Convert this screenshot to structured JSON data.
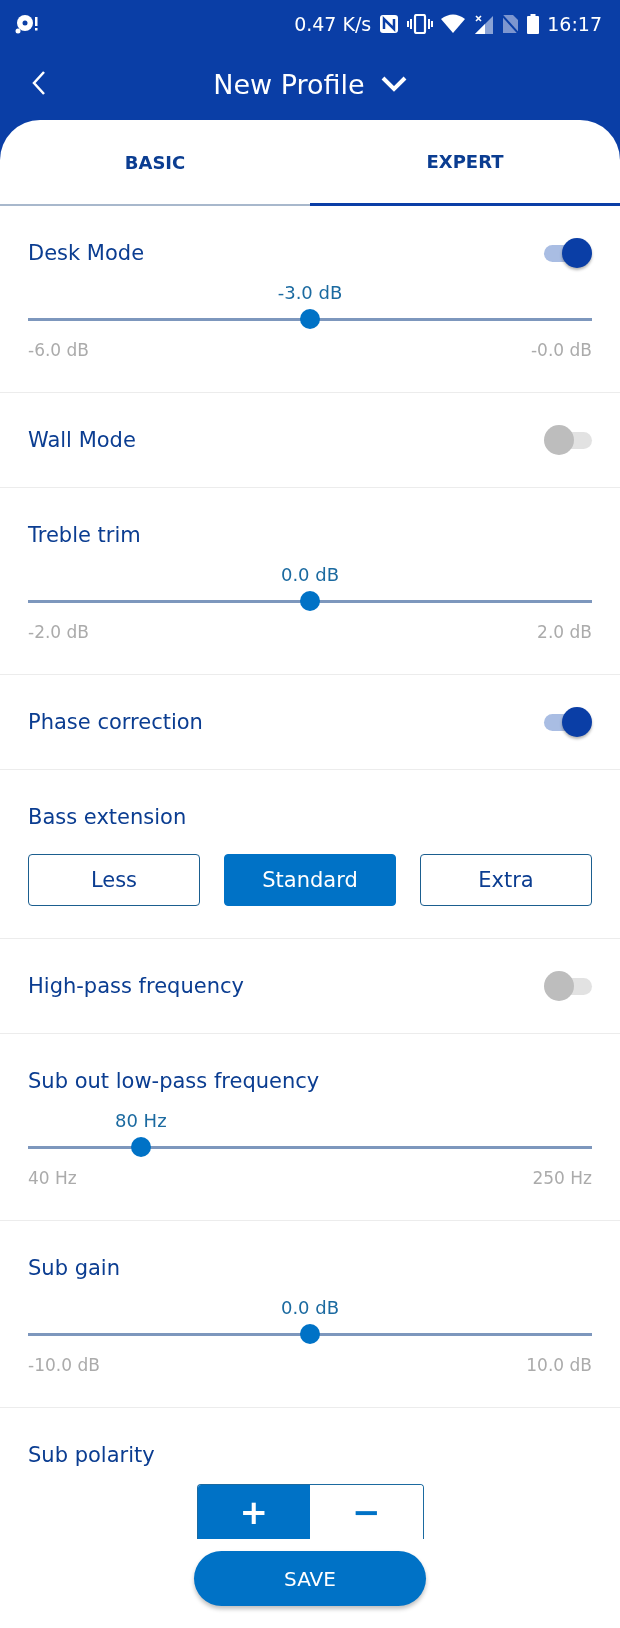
{
  "status_bar": {
    "speed": "0.47 K/s",
    "time": "16:17"
  },
  "header": {
    "title": "New Profile"
  },
  "tabs": [
    {
      "label": "BASIC",
      "selected": false
    },
    {
      "label": "EXPERT",
      "selected": true
    }
  ],
  "sections": [
    {
      "kind": "toggle",
      "label": "Desk Mode",
      "on": true,
      "slider": {
        "value": "-3.0 dB",
        "min": "-6.0 dB",
        "max": "-0.0 dB",
        "level": 0.5
      }
    },
    {
      "kind": "toggle",
      "label": "Wall Mode",
      "on": false
    },
    {
      "kind": "slider",
      "label": "Treble trim",
      "slider": {
        "value": "0.0 dB",
        "min": "-2.0 dB",
        "max": "2.0 dB",
        "level": 0.5
      }
    },
    {
      "kind": "toggle",
      "label": "Phase correction",
      "on": true
    },
    {
      "kind": "choice",
      "label": "Bass extension",
      "options": [
        {
          "label": "Less",
          "selected": false
        },
        {
          "label": "Standard",
          "selected": true
        },
        {
          "label": "Extra",
          "selected": false
        }
      ]
    },
    {
      "kind": "toggle",
      "label": "High-pass frequency",
      "on": false
    },
    {
      "kind": "slider",
      "label": "Sub out low-pass frequency",
      "slider": {
        "value": "80 Hz",
        "min": "40 Hz",
        "max": "250 Hz",
        "level": 0.2
      }
    },
    {
      "kind": "slider",
      "label": "Sub gain",
      "slider": {
        "value": "0.0 dB",
        "min": "-10.0 dB",
        "max": "10.0 dB",
        "level": 0.5
      }
    },
    {
      "kind": "polarity",
      "label": "Sub polarity",
      "options": [
        {
          "label": "+",
          "selected": true
        },
        {
          "label": "−",
          "selected": false
        }
      ]
    }
  ],
  "save_button": "SAVE"
}
